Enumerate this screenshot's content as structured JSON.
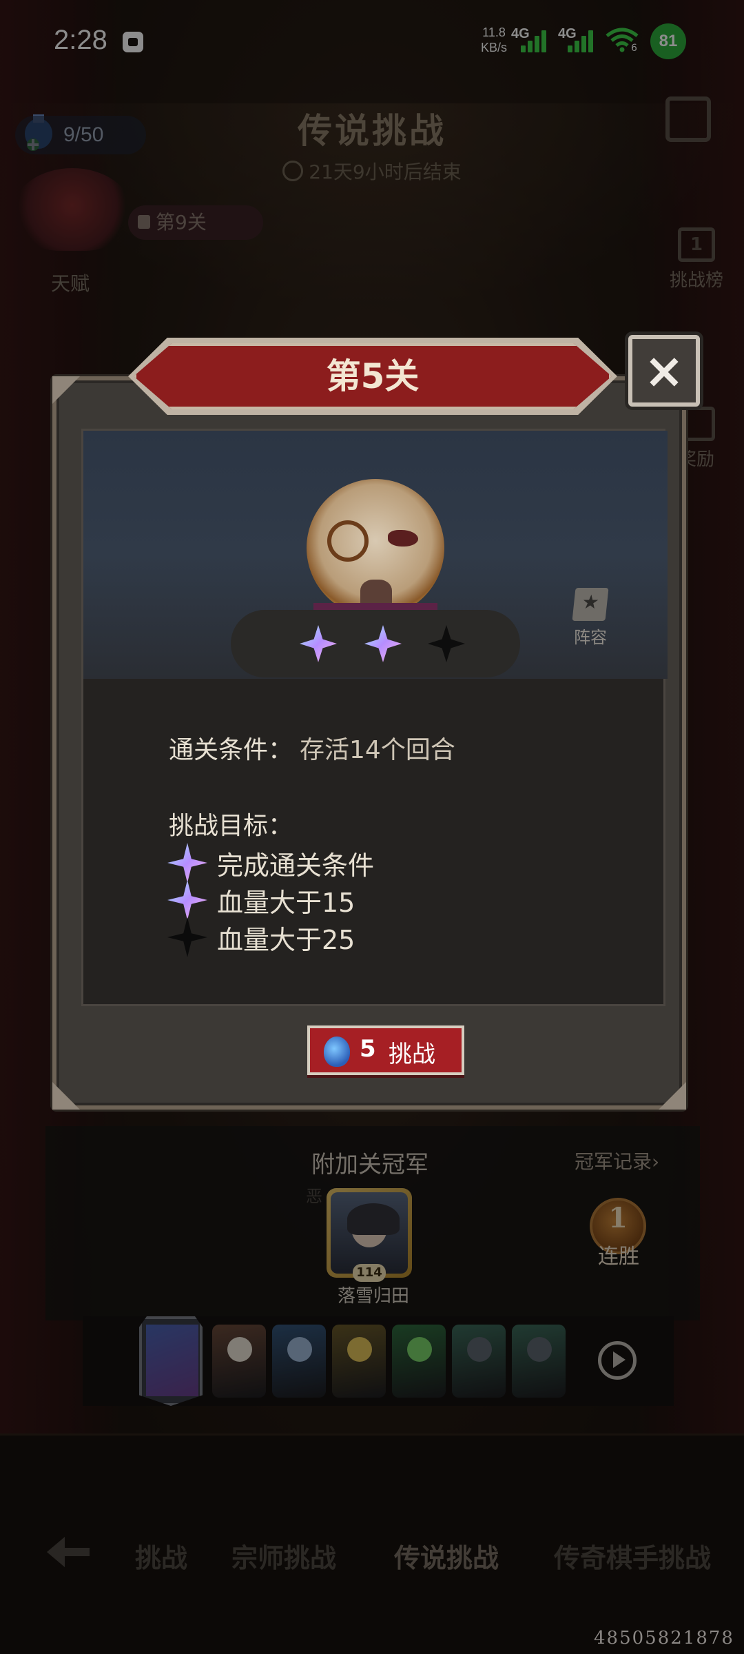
{
  "status_bar": {
    "time": "2:28",
    "net_speed_value": "11.8",
    "net_speed_unit": "KB/s",
    "signal1_label": "4G",
    "signal2_label": "4G",
    "wifi_sub": "6",
    "battery": "81"
  },
  "hud": {
    "energy": "9/50",
    "title": "传说挑战",
    "countdown": "21天9小时后结束",
    "talent_label": "天赋",
    "level_pill": "第9关",
    "side_items": [
      "挑战榜",
      "奖励"
    ],
    "side_rank": "1"
  },
  "modal": {
    "stage_title": "第5关",
    "close_glyph": "×",
    "lineup_label": "阵容",
    "stars": [
      true,
      true,
      false
    ],
    "condition_label": "通关条件：",
    "condition_value": "存活14个回合",
    "goals_title": "挑战目标：",
    "goals": [
      {
        "text": "完成通关条件",
        "achieved": true
      },
      {
        "text": "血量大于15",
        "achieved": true
      },
      {
        "text": "血量大于25",
        "achieved": false
      }
    ],
    "challenge_cost": "5",
    "challenge_label": "挑战"
  },
  "champion": {
    "title": "附加关冠军",
    "record_link": "冠军记录›",
    "sub": "恶 … 40",
    "level": "114",
    "name": "落雪归田",
    "streak_num": "1",
    "streak_label": "连胜"
  },
  "team": {
    "heroes": [
      {
        "name": "hero-1",
        "color": "#6b4a3a",
        "head": "#e9e2d6"
      },
      {
        "name": "hero-2",
        "color": "#34557a",
        "head": "#9fb8d8"
      },
      {
        "name": "hero-3",
        "color": "#6a5a2a",
        "head": "#e2c35a"
      },
      {
        "name": "hero-4",
        "color": "#2f6b3e",
        "head": "#7bd36a"
      },
      {
        "name": "hero-5",
        "color": "#3c6a5a",
        "head": "#5d6670"
      },
      {
        "name": "hero-6",
        "color": "#3c6a5a",
        "head": "#5d6670"
      }
    ]
  },
  "bottom_tabs": [
    "挑战",
    "宗师挑战",
    "传说挑战",
    "传奇棋手挑战"
  ],
  "watermark": "48505821878"
}
